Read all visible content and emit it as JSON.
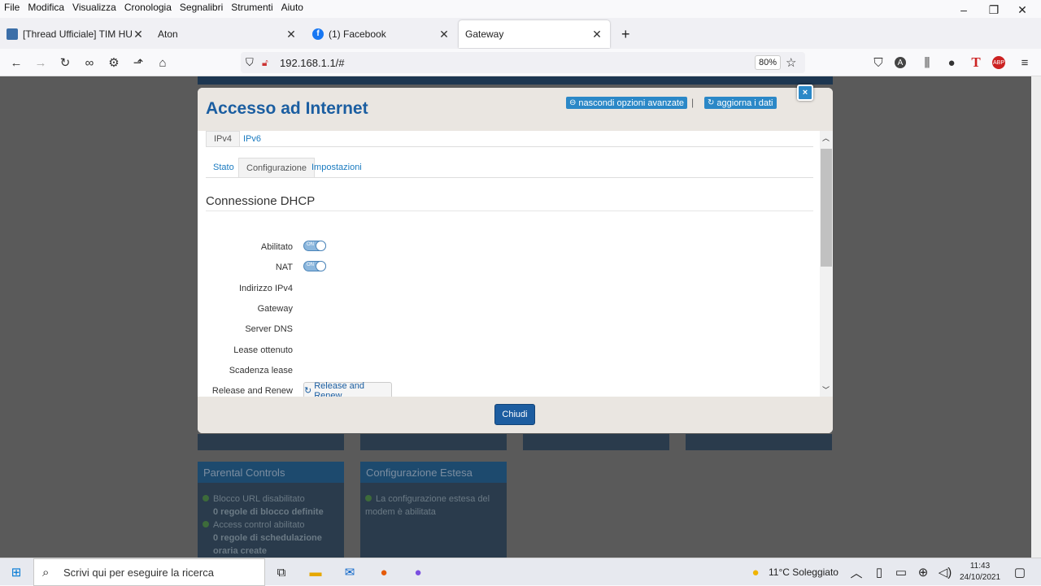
{
  "menubar": {
    "items": [
      "File",
      "Modifica",
      "Visualizza",
      "Cronologia",
      "Segnalibri",
      "Strumenti",
      "Aiuto"
    ]
  },
  "window": {
    "minimize": "–",
    "maximize": "❐",
    "close": "✕"
  },
  "tabs": [
    {
      "title": "[Thread Ufficiale] TIM HUB (DGA",
      "icon": "document-icon"
    },
    {
      "title": "Aton",
      "icon": ""
    },
    {
      "title": "(1) Facebook",
      "icon": "facebook-icon"
    },
    {
      "title": "Gateway",
      "icon": "",
      "active": true
    }
  ],
  "toolbar": {
    "url": "192.168.1.1/#",
    "zoom": "80%"
  },
  "background_tiles": [
    {
      "title": "Parental Controls",
      "lines": [
        "Blocco URL disabilitato",
        "0 regole di blocco definite",
        "Access control abilitato",
        "0 regole di schedulazione oraria create"
      ]
    },
    {
      "title": "Configurazione Estesa",
      "lines": [
        "La configurazione estesa del modem è abilitata"
      ]
    }
  ],
  "modal": {
    "title": "Accesso ad Internet",
    "hide_advanced": "nascondi opzioni avanzate",
    "separator": "|",
    "refresh": "aggiorna i dati",
    "close_x": "×",
    "protocol_tabs": [
      "IPv4",
      "IPv6"
    ],
    "sub_tabs": [
      "Stato",
      "Configurazione",
      "Impostazioni"
    ],
    "section_title": "Connessione DHCP",
    "fields": [
      {
        "label": "Abilitato",
        "type": "switch",
        "value": "ON"
      },
      {
        "label": "NAT",
        "type": "switch",
        "value": "ON"
      },
      {
        "label": "Indirizzo IPv4",
        "type": "text",
        "value": ""
      },
      {
        "label": "Gateway",
        "type": "text",
        "value": ""
      },
      {
        "label": "Server DNS",
        "type": "text",
        "value": ""
      },
      {
        "label": "Lease ottenuto",
        "type": "text",
        "value": ""
      },
      {
        "label": "Scadenza lease",
        "type": "text",
        "value": ""
      },
      {
        "label": "Release and Renew",
        "type": "button",
        "value": "Release and Renew"
      }
    ],
    "close_button": "Chiudi"
  },
  "taskbar": {
    "search_placeholder": "Scrivi qui per eseguire la ricerca",
    "weather": "11°C  Soleggiato",
    "time": "11:43",
    "date": "24/10/2021"
  },
  "colors": {
    "accent": "#1b5ea1",
    "button": "#2b88c7",
    "page_bg": "#5a5a5a"
  }
}
